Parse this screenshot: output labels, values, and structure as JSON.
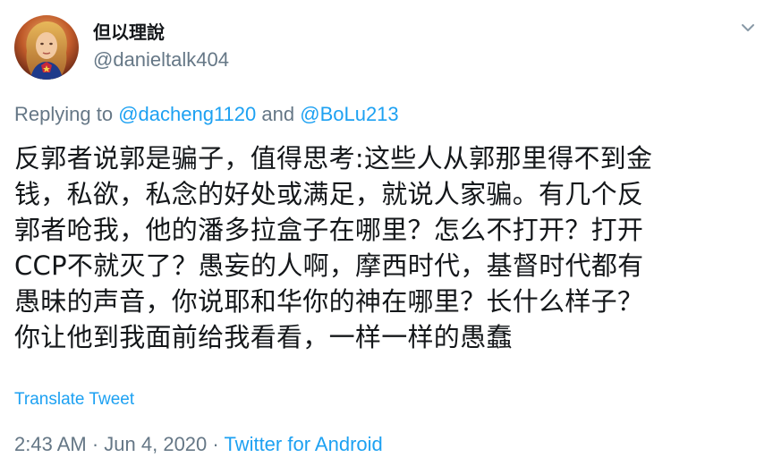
{
  "tweet": {
    "author": {
      "display_name": "但以理說",
      "handle": "@danieltalk404",
      "avatar_icon": "avatar-captain-marvel"
    },
    "menu_icon": "chevron-down-icon",
    "reply": {
      "prefix": "Replying to",
      "mention_1": "@dacheng1120",
      "conjunction": "and",
      "mention_2": "@BoLu213"
    },
    "text_lines": [
      "反郭者说郭是骗子，值得思考:这些人从郭那里得不到金",
      "钱，私欲，私念的好处或满足，就说人家骗。有几个反",
      "郭者呛我，他的潘多拉盒子在哪里？怎么不打开？打开",
      "CCP不就灭了？愚妄的人啊，摩西时代，基督时代都有",
      "愚昧的声音，你说耶和华你的神在哪里？长什么样子？",
      "你让他到我面前给我看看，一样一样的愚蠢"
    ],
    "translate_label": "Translate Tweet",
    "meta": {
      "time": "2:43 AM",
      "date": "Jun 4, 2020",
      "separator": "·",
      "source": "Twitter for Android"
    }
  },
  "colors": {
    "primary_text": "#14171a",
    "secondary_text": "#657786",
    "link": "#1da1f2"
  }
}
